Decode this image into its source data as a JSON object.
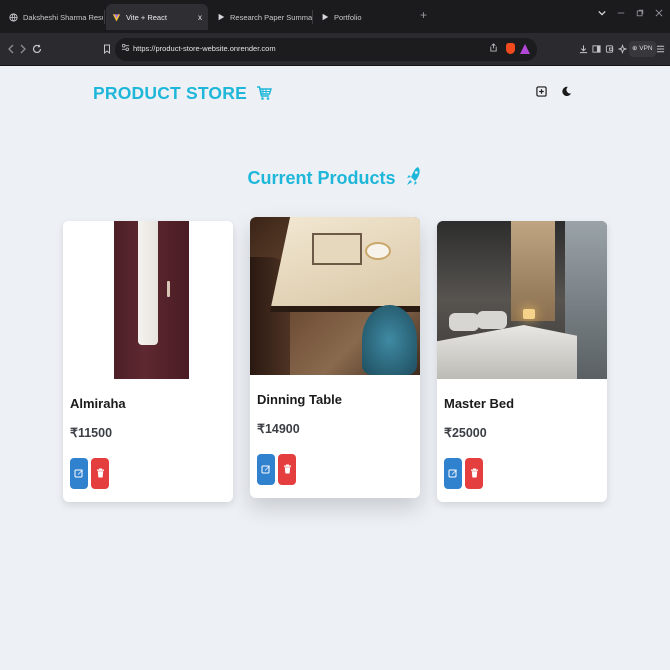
{
  "browser": {
    "tabs": [
      {
        "title": "Daksheshi Sharma Resume.pdf",
        "active": false
      },
      {
        "title": "Vite + React",
        "active": true,
        "close": "x"
      },
      {
        "title": "Research Paper Summarizer",
        "active": false
      },
      {
        "title": "Portfolio",
        "active": false
      }
    ],
    "new_tab": "+",
    "url": "https://product-store-website.onrender.com",
    "vpn_label": "VPN"
  },
  "app": {
    "brand": "PRODUCT STORE",
    "section_title": "Current Products",
    "products": [
      {
        "name": "Almiraha",
        "price": "₹11500"
      },
      {
        "name": "Dinning Table",
        "price": "₹14900"
      },
      {
        "name": "Master Bed",
        "price": "₹25000"
      }
    ]
  },
  "colors": {
    "accent": "#1fb7d9",
    "edit": "#3182ce",
    "delete": "#e53e3e",
    "page_bg": "#edf1f6"
  },
  "icons": {
    "brand": "shopping-cart-icon",
    "title": "rocket-icon",
    "navbar": [
      "plus-square-icon",
      "moon-icon"
    ],
    "card_actions": [
      "edit-icon",
      "trash-icon"
    ]
  }
}
